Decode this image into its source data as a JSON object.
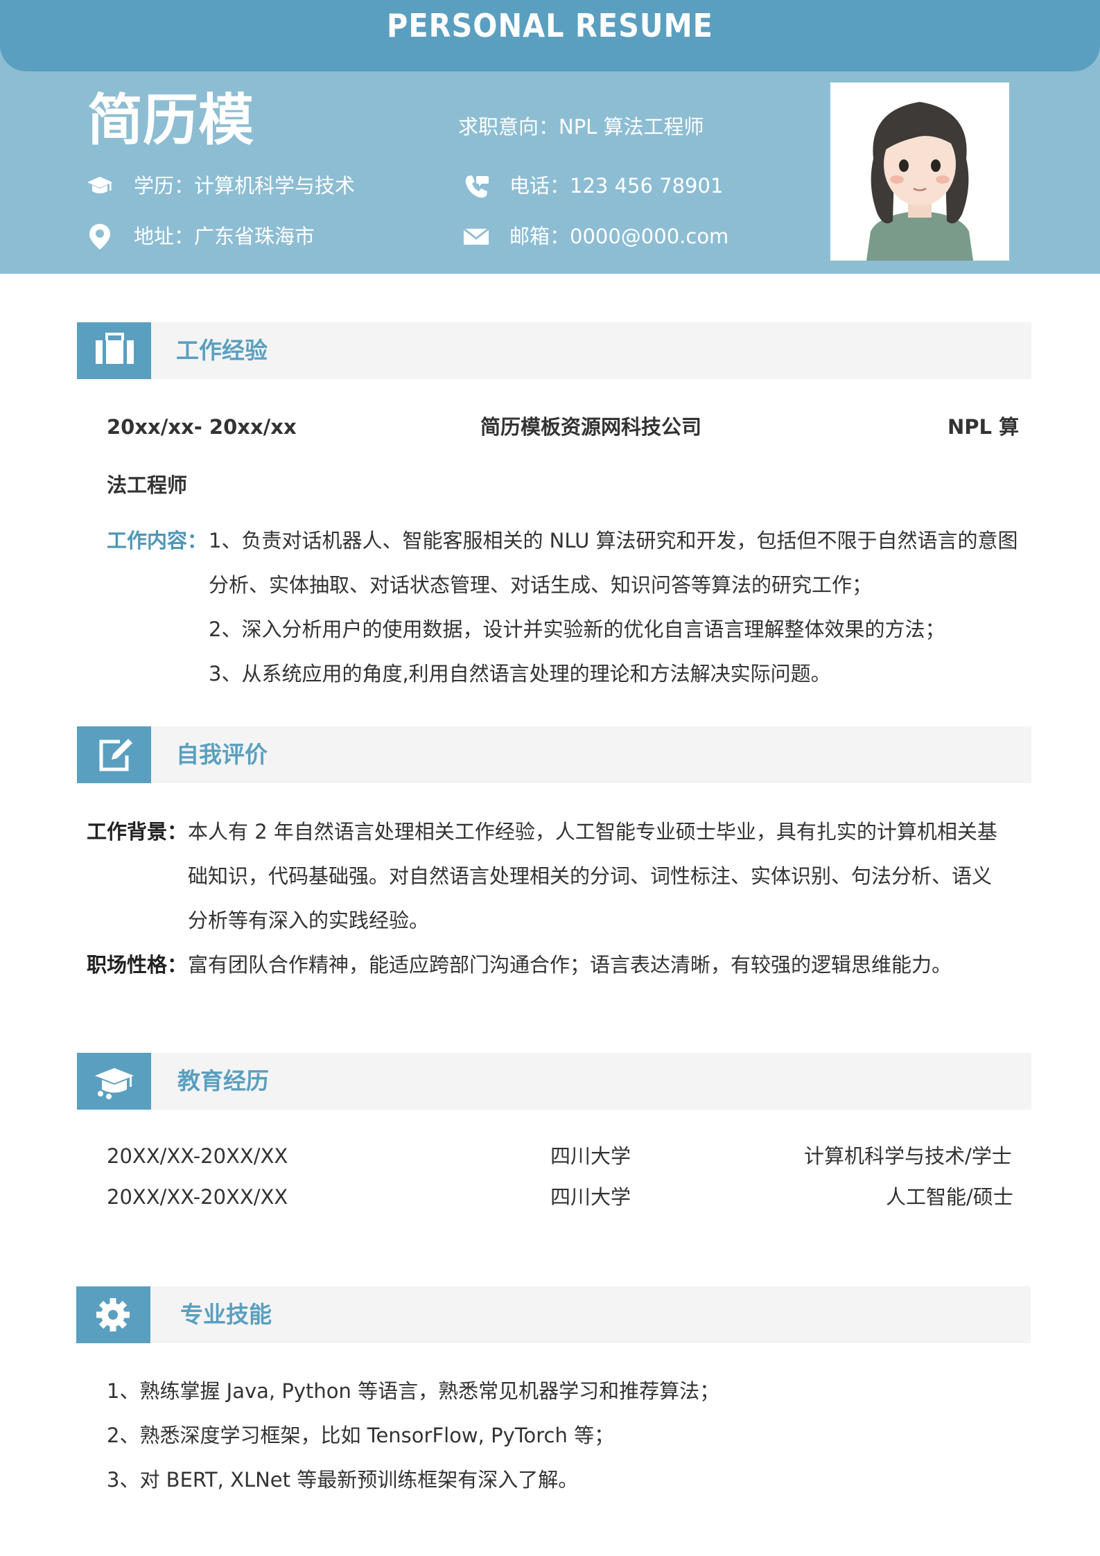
{
  "header": {
    "banner_title": "PERSONAL RESUME",
    "name": "简历模",
    "objective": "求职意向：NPL 算法工程师",
    "education": "学历：计算机科学与技术",
    "phone": "电话：123 456 78901",
    "address": "地址：广东省珠海市",
    "email": "邮箱：0000@000.com",
    "colors": {
      "accent": "#5a9fbf",
      "band": "#8dbdd3"
    }
  },
  "work": {
    "title": "工作经验",
    "period": "20xx/xx- 20xx/xx",
    "company": "简历模板资源网科技公司",
    "position_part1": "NPL 算",
    "position_part2": "法工程师",
    "content_label": "工作内容：",
    "lines": [
      "1、负责对话机器人、智能客服相关的 NLU 算法研究和开发，包括但不限于自然语言的意图",
      "分析、实体抽取、对话状态管理、对话生成、知识问答等算法的研究工作；",
      "2、深入分析用户的使用数据，设计并实验新的优化自言语言理解整体效果的方法；",
      "3、从系统应用的角度,利用自然语言处理的理论和方法解决实际问题。"
    ]
  },
  "self_eval": {
    "title": "自我评价",
    "bg_label": "工作背景：",
    "bg_lines": [
      "本人有 2 年自然语言处理相关工作经验，人工智能专业硕士毕业，具有扎实的计算机相关基",
      "础知识，代码基础强。对自然语言处理相关的分词、词性标注、实体识别、句法分析、语义",
      "分析等有深入的实践经验。"
    ],
    "personality_label": "职场性格：",
    "personality_text": "富有团队合作精神，能适应跨部门沟通合作；语言表达清晰，有较强的逻辑思维能力。"
  },
  "education": {
    "title": "教育经历",
    "rows": [
      {
        "period": "20XX/XX-20XX/XX",
        "school": "四川大学",
        "major": "计算机科学与技术/学士"
      },
      {
        "period": "20XX/XX-20XX/XX",
        "school": "四川大学",
        "major": "人工智能/硕士"
      }
    ]
  },
  "skills": {
    "title": "专业技能",
    "lines": [
      "1、熟练掌握 Java, Python 等语言，熟悉常见机器学习和推荐算法；",
      "2、熟悉深度学习框架，比如 TensorFlow, PyTorch 等；",
      "3、对 BERT, XLNet 等最新预训练框架有深入了解。"
    ]
  }
}
